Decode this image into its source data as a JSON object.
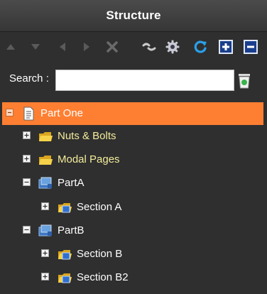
{
  "header": {
    "title": "Structure"
  },
  "toolbar": {
    "icons": [
      "move-up-icon",
      "move-down-icon",
      "move-left-icon",
      "move-right-icon",
      "delete-icon",
      "link-icon",
      "settings-icon",
      "refresh-icon",
      "expand-all-icon",
      "collapse-all-icon"
    ]
  },
  "search": {
    "label": "Search :",
    "value": "",
    "placeholder": ""
  },
  "tree": {
    "nodes": [
      {
        "label": "Part One",
        "level": 0,
        "expanded": true,
        "selected": true,
        "icon": "page-icon"
      },
      {
        "label": "Nuts & Bolts",
        "level": 1,
        "expanded": false,
        "icon": "folder-icon"
      },
      {
        "label": "Modal Pages",
        "level": 1,
        "expanded": false,
        "icon": "folder-icon"
      },
      {
        "label": "PartA",
        "level": 1,
        "expanded": true,
        "icon": "part-icon"
      },
      {
        "label": "Section A",
        "level": 2,
        "expanded": false,
        "icon": "section-icon"
      },
      {
        "label": "PartB",
        "level": 1,
        "expanded": true,
        "icon": "part-icon"
      },
      {
        "label": "Section B",
        "level": 2,
        "expanded": false,
        "icon": "section-icon"
      },
      {
        "label": "Section B2",
        "level": 2,
        "expanded": false,
        "icon": "section-icon"
      }
    ]
  },
  "colors": {
    "selected_row": "#ff7f32",
    "folder_label": "#f3ec9c",
    "background": "#2f2f2f"
  }
}
